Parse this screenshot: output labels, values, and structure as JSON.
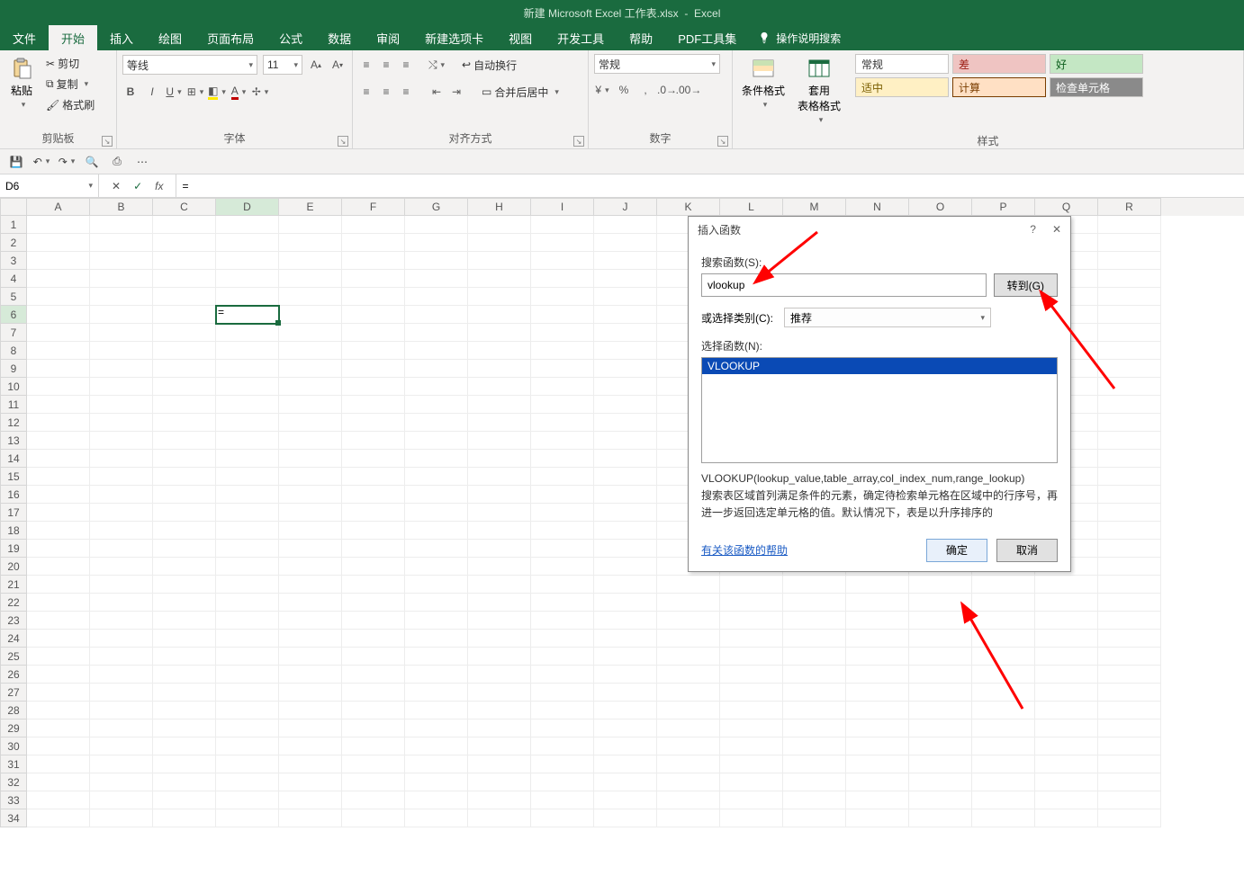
{
  "titlebar": {
    "document": "新建 Microsoft Excel 工作表.xlsx",
    "app": "Excel"
  },
  "menu": {
    "items": [
      "文件",
      "开始",
      "插入",
      "绘图",
      "页面布局",
      "公式",
      "数据",
      "审阅",
      "新建选项卡",
      "视图",
      "开发工具",
      "帮助",
      "PDF工具集"
    ],
    "active": "开始",
    "search": "操作说明搜索"
  },
  "ribbon": {
    "clipboard": {
      "paste": "粘贴",
      "cut": "剪切",
      "copy": "复制",
      "painter": "格式刷",
      "label": "剪贴板"
    },
    "font": {
      "name": "等线",
      "size": "11",
      "label": "字体"
    },
    "align": {
      "wrap": "自动换行",
      "merge": "合并后居中",
      "label": "对齐方式"
    },
    "number": {
      "format": "常规",
      "label": "数字"
    },
    "styles": {
      "cond": "条件格式",
      "table": "套用\n表格格式",
      "normal": "常规",
      "bad": "差",
      "good": "好",
      "mid": "适中",
      "calc": "计算",
      "check": "检查单元格",
      "label": "样式"
    }
  },
  "name_box": "D6",
  "formula": "=",
  "columns": [
    "A",
    "B",
    "C",
    "D",
    "E",
    "F",
    "G",
    "H",
    "I",
    "J",
    "K",
    "L",
    "M",
    "N",
    "O",
    "P",
    "Q",
    "R"
  ],
  "active_cell_value": "=",
  "dialog": {
    "title": "插入函数",
    "search_label": "搜索函数(S):",
    "search_value": "vlookup",
    "go_btn": "转到(G)",
    "category_label": "或选择类别(C):",
    "category_value": "推荐",
    "select_label": "选择函数(N):",
    "list_selected": "VLOOKUP",
    "signature": "VLOOKUP(lookup_value,table_array,col_index_num,range_lookup)",
    "description": "搜索表区域首列满足条件的元素，确定待检索单元格在区域中的行序号，再进一步返回选定单元格的值。默认情况下，表是以升序排序的",
    "help_link": "有关该函数的帮助",
    "ok": "确定",
    "cancel": "取消"
  }
}
